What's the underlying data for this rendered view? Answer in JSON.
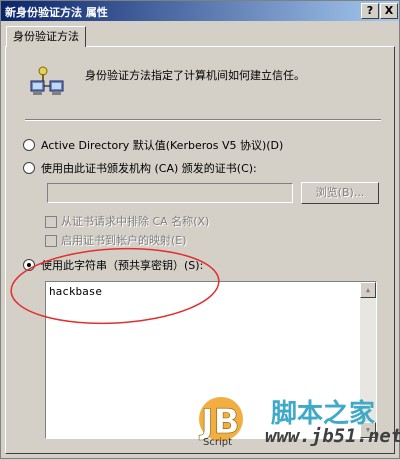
{
  "window": {
    "title": "新身份验证方法 属性",
    "help_label": "?",
    "close_label": "X"
  },
  "tabs": [
    {
      "label": "身份验证方法"
    }
  ],
  "description": "身份验证方法指定了计算机间如何建立信任。",
  "options": {
    "kerberos_label": "Active Directory 默认值(Kerberos V5 协议)(D)",
    "ca_label": "使用由此证书颁发机构 (CA) 颁发的证书(C):",
    "preshared_label": "使用此字符串（预共享密钥）(S):",
    "selected": "preshared"
  },
  "cert_field": {
    "value": ""
  },
  "browse_button": {
    "label": "浏览(B)..."
  },
  "checkboxes": {
    "exclude_ca_label": "从证书请求中排除 CA 名称(X)",
    "account_mapping_label": "启用证书到帐户的映射(E)"
  },
  "preshared_key": {
    "value": "hackbase"
  },
  "watermark": {
    "logo_text": "JB",
    "script_label": "Script",
    "site_name": "脚本之家",
    "site_url": "www.jb51.net"
  },
  "colors": {
    "annotation": "#e03030",
    "titlebar": "#0a246a",
    "watermark_text": "#3fa9c8"
  }
}
